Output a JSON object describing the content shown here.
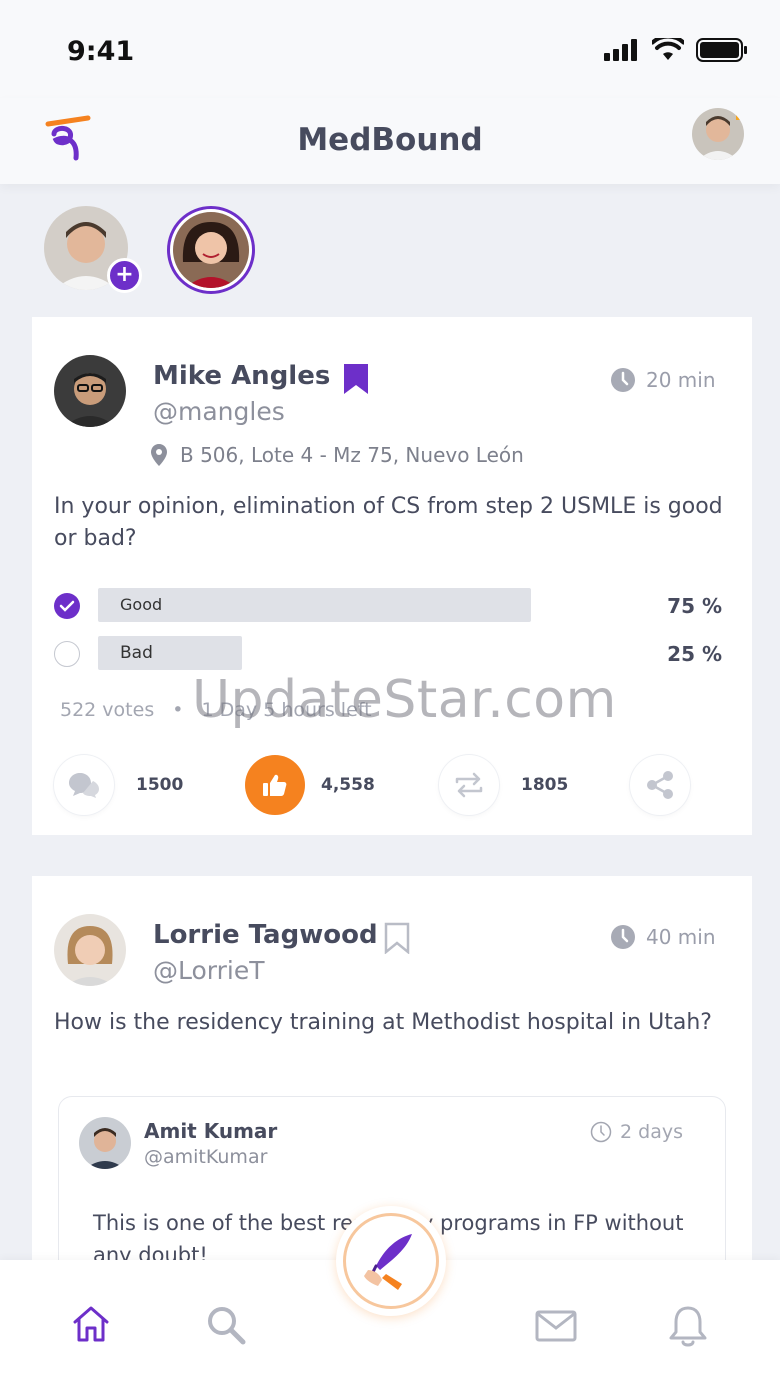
{
  "status_bar": {
    "time": "9:41"
  },
  "header": {
    "title": "MedBound"
  },
  "posts": [
    {
      "author": "Mike Angles",
      "handle": "@mangles",
      "time": "20 min",
      "location": "B 506, Lote 4 - Mz 75, Nuevo León",
      "question": "In your opinion, elimination of CS from step 2 USMLE is good or bad?",
      "poll": [
        {
          "label": "Good",
          "percent": "75 %",
          "share": 0.75,
          "selected": true
        },
        {
          "label": "Bad",
          "percent": "25 %",
          "share": 0.25,
          "selected": false
        }
      ],
      "votes": "522 votes",
      "separator": "•",
      "time_left": "1 Day 5 hours left",
      "comments": "1500",
      "likes": "4,558",
      "reposts": "1805"
    },
    {
      "author": "Lorrie Tagwood",
      "handle": "@LorrieT",
      "time": "40 min",
      "question": "How is the residency training at Methodist hospital in Utah?",
      "reply": {
        "author": "Amit Kumar",
        "handle": "@amitKumar",
        "time": "2 days",
        "text": "This is one of the best residency programs in FP without any doubt!"
      }
    }
  ],
  "watermark": "UpdateStar.com",
  "colors": {
    "accent": "#6d2fc9",
    "like": "#f5821f",
    "text": "#474b5e"
  }
}
